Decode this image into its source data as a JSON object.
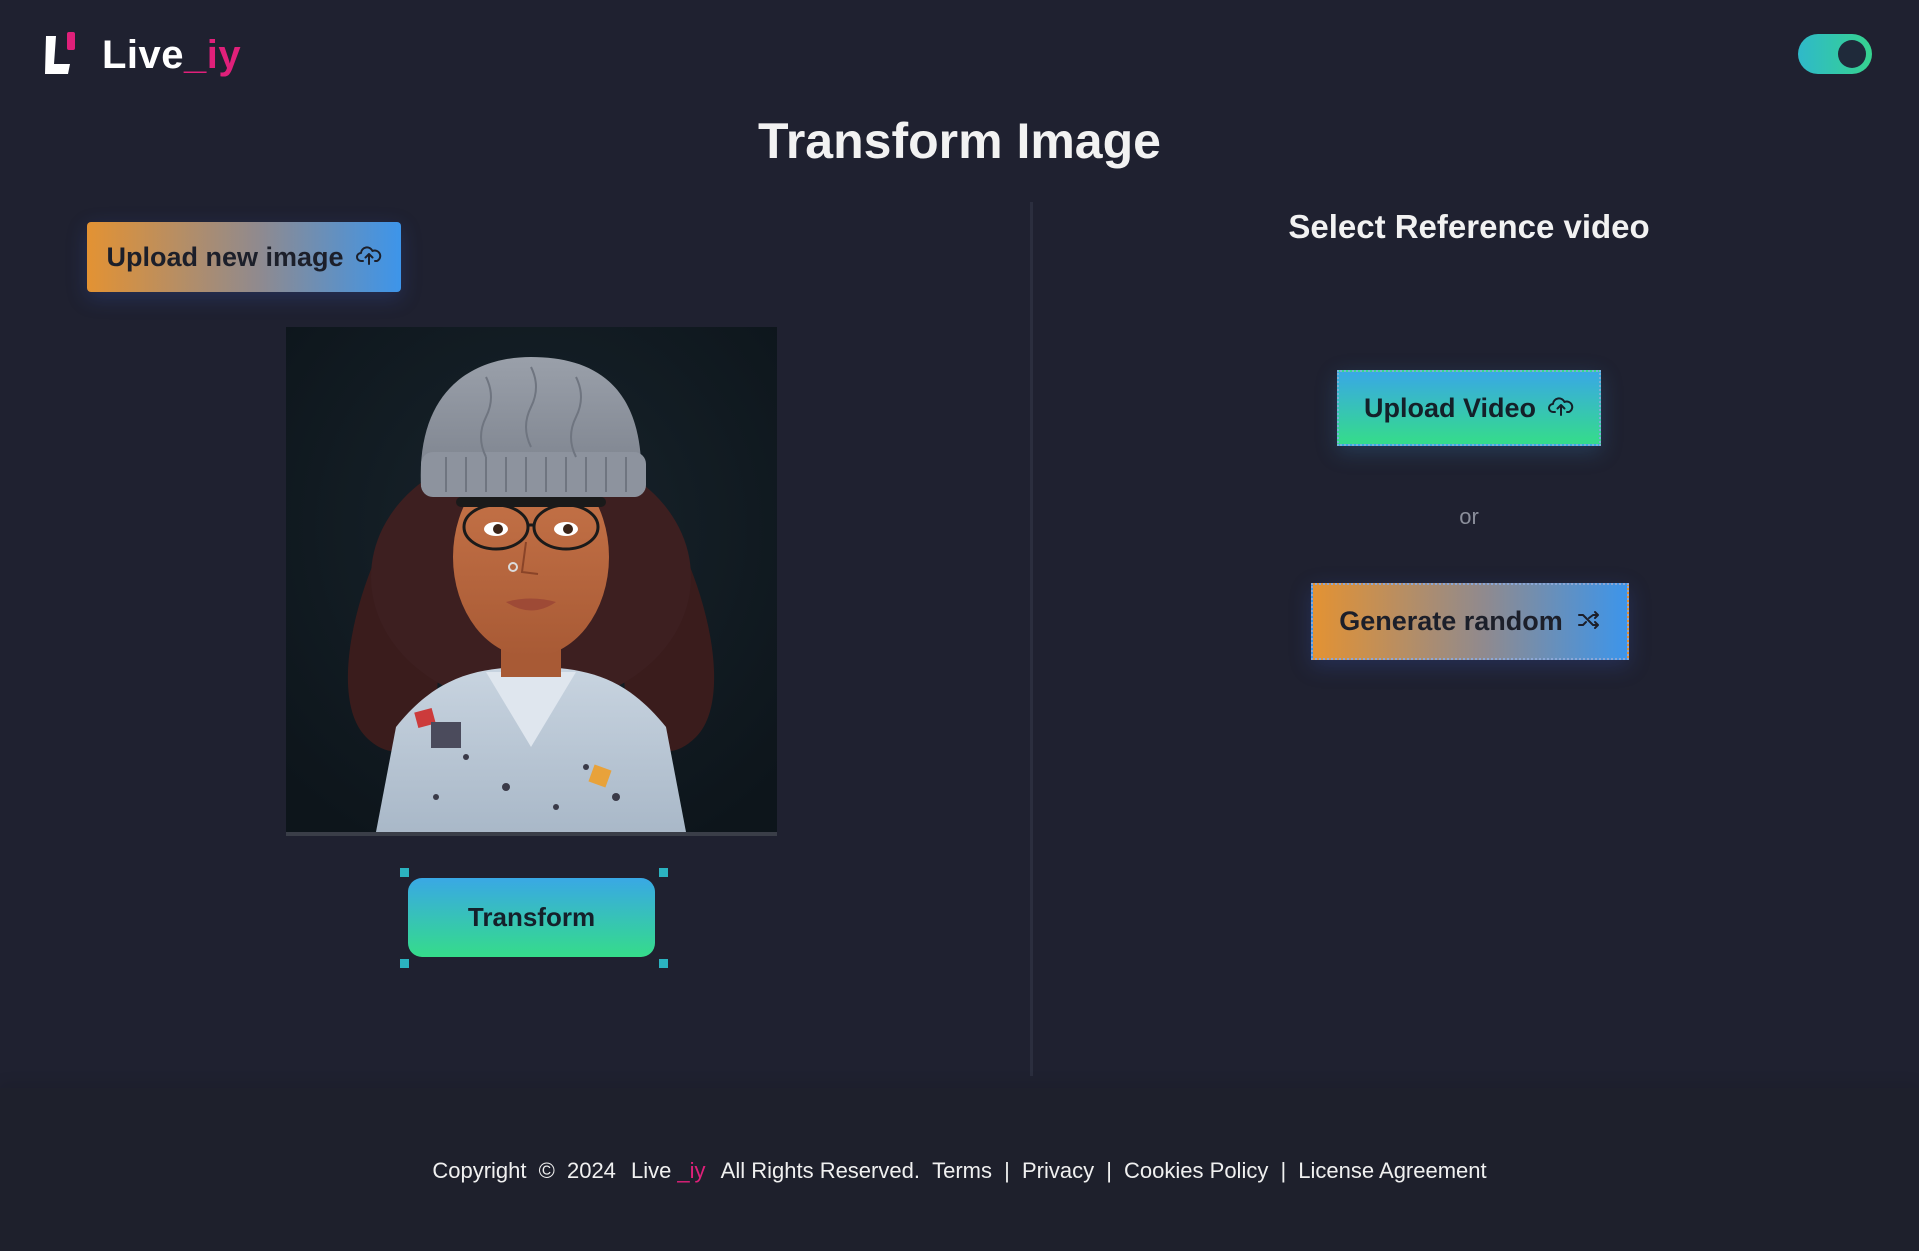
{
  "header": {
    "brand_main": "Live",
    "brand_accent": "_iy",
    "theme_toggle_state": "on"
  },
  "page": {
    "title": "Transform Image"
  },
  "left_panel": {
    "upload_button_label": "Upload new image",
    "upload_icon": "cloud-upload-icon",
    "transform_button_label": "Transform"
  },
  "right_panel": {
    "title": "Select Reference video",
    "upload_video_label": "Upload Video",
    "upload_video_icon": "cloud-upload-icon",
    "or_text": "or",
    "generate_random_label": "Generate random",
    "generate_random_icon": "shuffle-icon"
  },
  "footer": {
    "copyright": "Copyright",
    "symbol": "©",
    "year": "2024",
    "brand_main": "Live",
    "brand_accent": "_iy",
    "rights": "All Rights Reserved.",
    "links": [
      "Terms",
      "Privacy",
      "Cookies Policy",
      "License Agreement"
    ],
    "separator": "|"
  },
  "colors": {
    "background": "#1f2130",
    "accent_pink": "#e0207a",
    "gradient_warm_start": "#e39233",
    "gradient_warm_end": "#3d95ea",
    "gradient_cool_start": "#39a8e5",
    "gradient_cool_end": "#35dc8a"
  }
}
